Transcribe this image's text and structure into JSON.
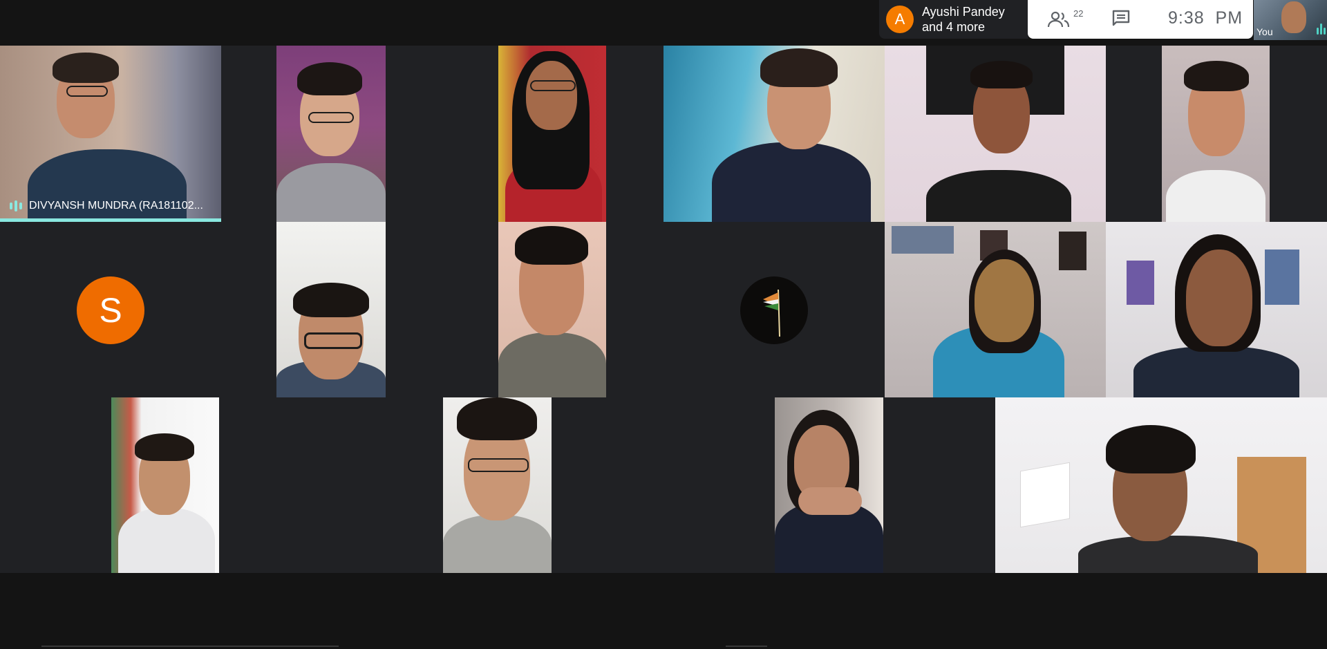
{
  "header": {
    "presenter": {
      "avatar_initial": "A",
      "name": "Ayushi Pandey",
      "more": "and 4 more",
      "avatar_color": "#f57c00"
    },
    "participants_count": "22",
    "clock": "9:38  PM",
    "self_view_label": "You",
    "people_icon": "people-icon",
    "chat_icon": "chat-icon"
  },
  "grid": {
    "active_speaker_label": "DIVYANSH MUNDRA (RA181102...",
    "active_color": "#8ae8e0",
    "placeholder_s": {
      "initial": "S",
      "color": "#ef6c00"
    }
  }
}
